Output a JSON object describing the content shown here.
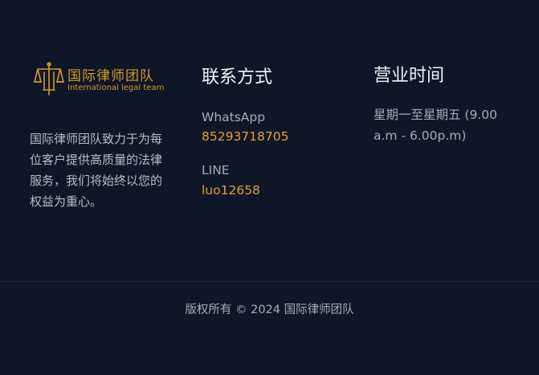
{
  "brand": {
    "name_cn": "国际律师团队",
    "name_en": "International legal team",
    "accent_color": "#d79a2c",
    "logo_icon": "scales-of-justice-icon"
  },
  "about": {
    "text": "国际律师团队致力于为每位客户提供高质量的法律服务，我们将始终以您的权益为重心。"
  },
  "contact": {
    "title": "联系方式",
    "whatsapp_label": "WhatsApp",
    "whatsapp_value": "85293718705",
    "line_label": "LINE",
    "line_value": "luo12658",
    "link_color": "#e5a03a"
  },
  "hours": {
    "title": "营业时间",
    "text": "星期一至星期五 (9.00 a.m - 6.00p.m)"
  },
  "footer": {
    "copyright": "版权所有  © 2024 国际律师团队"
  }
}
